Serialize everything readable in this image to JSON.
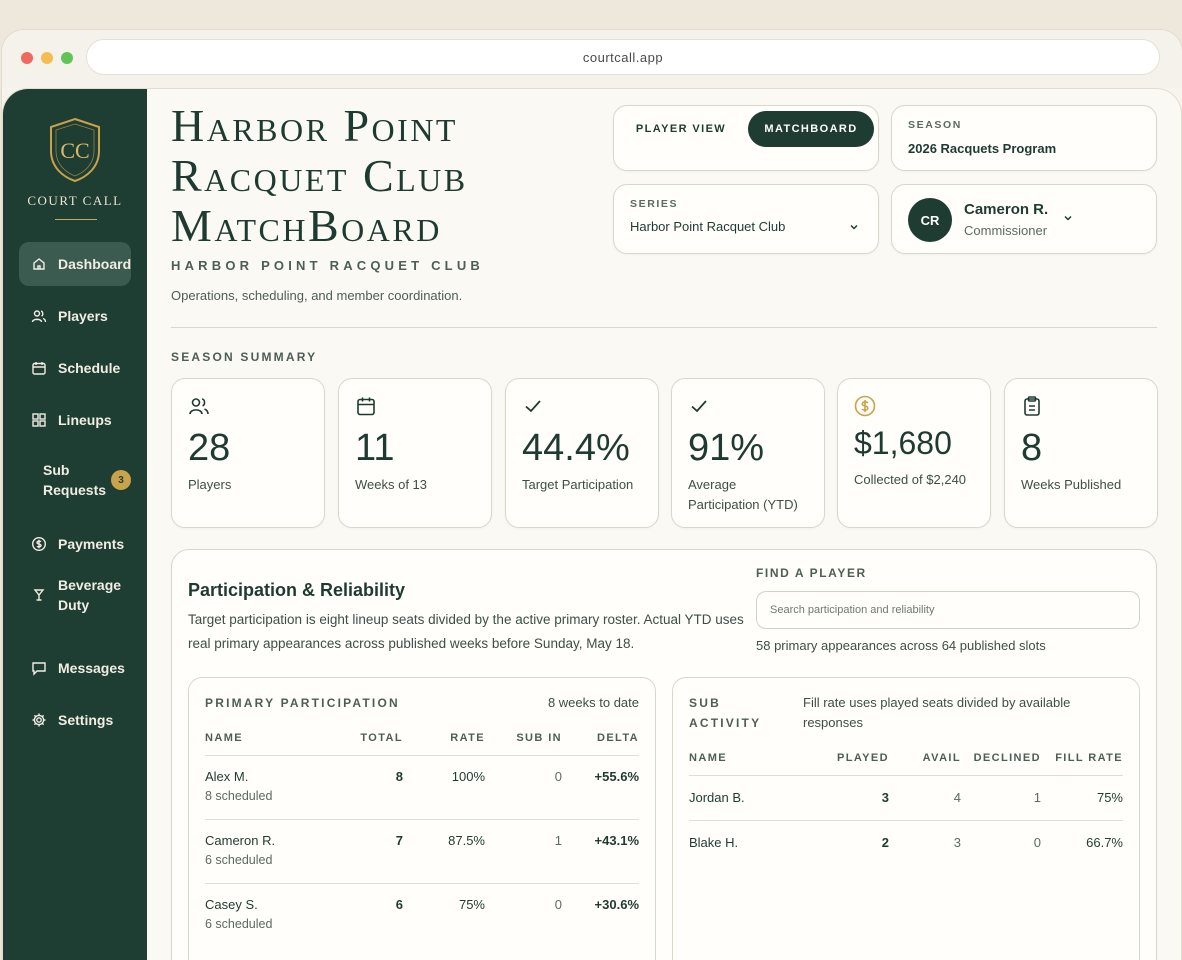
{
  "browser": {
    "url": "courtcall.app"
  },
  "brand": {
    "name": "COURT CALL",
    "monogram": "CC"
  },
  "nav": [
    {
      "label": "Dashboard",
      "icon": "home-icon",
      "active": true
    },
    {
      "label": "Players",
      "icon": "users-icon"
    },
    {
      "label": "Schedule",
      "icon": "calendar-icon"
    },
    {
      "label": "Lineups",
      "icon": "grid-icon"
    },
    {
      "label": "Sub Requests",
      "icon": "none",
      "badge": "3"
    },
    {
      "label": "Payments",
      "icon": "dollar-circle-icon"
    },
    {
      "label": "Beverage Duty",
      "icon": "glass-icon"
    },
    {
      "label": "Messages",
      "icon": "message-icon"
    },
    {
      "label": "Settings",
      "icon": "gear-icon"
    }
  ],
  "header": {
    "title": "Harbor Point Racquet Club MatchBoard",
    "org": "HARBOR POINT RACQUET CLUB",
    "subtitle": "Operations, scheduling, and member coordination."
  },
  "view_toggle": {
    "player_view": "PLAYER VIEW",
    "matchboard": "MATCHBOARD",
    "active": "matchboard"
  },
  "season": {
    "label": "SEASON",
    "value": "2026 Racquets Program"
  },
  "series": {
    "label": "SERIES",
    "value": "Harbor Point Racquet Club"
  },
  "user": {
    "initials": "CR",
    "name": "Cameron R.",
    "role": "Commissioner"
  },
  "summary": {
    "label": "SEASON SUMMARY",
    "stats": [
      {
        "value": "28",
        "label": "Players",
        "icon": "users-icon"
      },
      {
        "value": "11",
        "label": "Weeks of 13",
        "icon": "calendar-icon"
      },
      {
        "value": "44.4%",
        "label": "Target Participation",
        "icon": "check-icon"
      },
      {
        "value": "91%",
        "label": "Average Participation (YTD)",
        "icon": "check-icon"
      },
      {
        "value": "$1,680",
        "label": "Collected of $2,240",
        "icon": "dollar-circle-icon"
      },
      {
        "value": "8",
        "label": "Weeks Published",
        "icon": "clipboard-icon"
      }
    ]
  },
  "participation": {
    "title": "Participation & Reliability",
    "description": "Target participation is eight lineup seats divided by the active primary roster. Actual YTD uses real primary appearances across published weeks before Sunday, May 18.",
    "find_label": "FIND A PLAYER",
    "search_placeholder": "Search participation and reliability",
    "find_note": "58 primary appearances across 64 published slots",
    "primary": {
      "title": "PRIMARY PARTICIPATION",
      "note": "8 weeks to date",
      "columns": [
        "NAME",
        "TOTAL",
        "RATE",
        "SUB IN",
        "DELTA"
      ],
      "rows": [
        {
          "name": "Alex M.",
          "scheduled": "8 scheduled",
          "total": "8",
          "rate": "100%",
          "sub_in": "0",
          "delta": "+55.6%"
        },
        {
          "name": "Cameron R.",
          "scheduled": "6 scheduled",
          "total": "7",
          "rate": "87.5%",
          "sub_in": "1",
          "delta": "+43.1%"
        },
        {
          "name": "Casey S.",
          "scheduled": "6 scheduled",
          "total": "6",
          "rate": "75%",
          "sub_in": "0",
          "delta": "+30.6%"
        }
      ]
    },
    "sub_activity": {
      "title": "SUB ACTIVITY",
      "note": "Fill rate uses played seats divided by available responses",
      "columns": [
        "NAME",
        "PLAYED",
        "AVAIL",
        "DECLINED",
        "FILL RATE"
      ],
      "rows": [
        {
          "name": "Jordan B.",
          "played": "3",
          "avail": "4",
          "declined": "1",
          "fill_rate": "75%"
        },
        {
          "name": "Blake H.",
          "played": "2",
          "avail": "3",
          "declined": "0",
          "fill_rate": "66.7%"
        }
      ]
    }
  },
  "colors": {
    "sidebar": "#1e3d33",
    "accent_gold": "#c9a24a",
    "text_dark": "#1e3b32",
    "background": "#fbf9f3"
  }
}
